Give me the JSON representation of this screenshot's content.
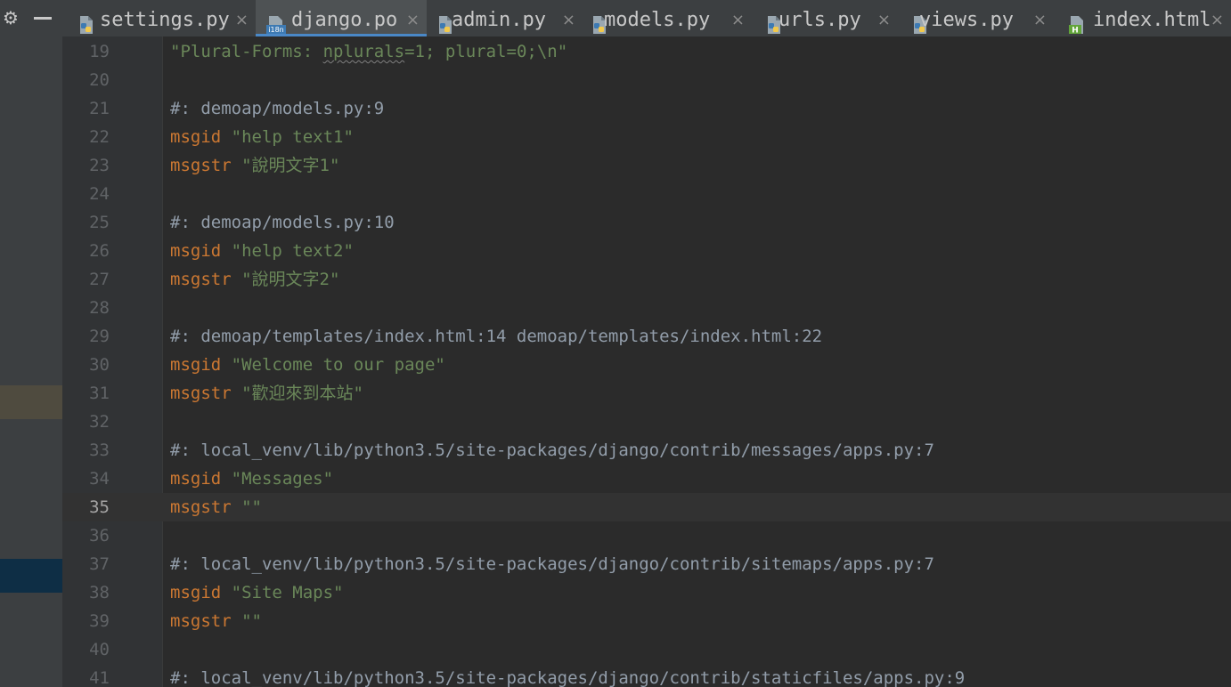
{
  "tabs": [
    {
      "label": "settings.py",
      "icon": "python-file-icon",
      "active": false
    },
    {
      "label": "django.po",
      "icon": "i18n-file-icon",
      "active": true
    },
    {
      "label": "admin.py",
      "icon": "python-file-icon",
      "active": false
    },
    {
      "label": "models.py",
      "icon": "python-file-icon",
      "active": false
    },
    {
      "label": "urls.py",
      "icon": "python-file-icon",
      "active": false
    },
    {
      "label": "views.py",
      "icon": "python-file-icon",
      "active": false
    },
    {
      "label": "index.html",
      "icon": "html-file-icon",
      "active": false
    }
  ],
  "close_glyph": "×",
  "i18n_badge": "i18n",
  "html_badge": "H",
  "editor": {
    "current_line": "35",
    "lines": [
      {
        "num": "19",
        "parts": [
          [
            "str",
            "\"Plural-Forms: "
          ],
          [
            "strsq",
            "nplurals"
          ],
          [
            "str",
            "=1; plural=0;\\n\""
          ]
        ]
      },
      {
        "num": "20",
        "parts": []
      },
      {
        "num": "21",
        "parts": [
          [
            "comment",
            "#: demoap/models.py:9"
          ]
        ]
      },
      {
        "num": "22",
        "parts": [
          [
            "kw",
            "msgid"
          ],
          [
            "plain",
            " "
          ],
          [
            "str",
            "\"help text1\""
          ]
        ]
      },
      {
        "num": "23",
        "parts": [
          [
            "kw",
            "msgstr"
          ],
          [
            "plain",
            " "
          ],
          [
            "str",
            "\"說明文字1\""
          ]
        ]
      },
      {
        "num": "24",
        "parts": []
      },
      {
        "num": "25",
        "parts": [
          [
            "comment",
            "#: demoap/models.py:10"
          ]
        ]
      },
      {
        "num": "26",
        "parts": [
          [
            "kw",
            "msgid"
          ],
          [
            "plain",
            " "
          ],
          [
            "str",
            "\"help text2\""
          ]
        ]
      },
      {
        "num": "27",
        "parts": [
          [
            "kw",
            "msgstr"
          ],
          [
            "plain",
            " "
          ],
          [
            "str",
            "\"說明文字2\""
          ]
        ]
      },
      {
        "num": "28",
        "parts": []
      },
      {
        "num": "29",
        "parts": [
          [
            "comment",
            "#: demoap/templates/index.html:14 demoap/templates/index.html:22"
          ]
        ]
      },
      {
        "num": "30",
        "parts": [
          [
            "kw",
            "msgid"
          ],
          [
            "plain",
            " "
          ],
          [
            "str",
            "\"Welcome to our page\""
          ]
        ]
      },
      {
        "num": "31",
        "parts": [
          [
            "kw",
            "msgstr"
          ],
          [
            "plain",
            " "
          ],
          [
            "str",
            "\"歡迎來到本站\""
          ]
        ]
      },
      {
        "num": "32",
        "parts": []
      },
      {
        "num": "33",
        "parts": [
          [
            "comment",
            "#: local_venv/lib/python3.5/site-packages/django/contrib/messages/apps.py:7"
          ]
        ]
      },
      {
        "num": "34",
        "parts": [
          [
            "kw",
            "msgid"
          ],
          [
            "plain",
            " "
          ],
          [
            "str",
            "\"Messages\""
          ]
        ]
      },
      {
        "num": "35",
        "parts": [
          [
            "kw",
            "msgstr"
          ],
          [
            "plain",
            " "
          ],
          [
            "str",
            "\"\""
          ]
        ]
      },
      {
        "num": "36",
        "parts": []
      },
      {
        "num": "37",
        "parts": [
          [
            "comment",
            "#: local_venv/lib/python3.5/site-packages/django/contrib/sitemaps/apps.py:7"
          ]
        ]
      },
      {
        "num": "38",
        "parts": [
          [
            "kw",
            "msgid"
          ],
          [
            "plain",
            " "
          ],
          [
            "str",
            "\"Site Maps\""
          ]
        ]
      },
      {
        "num": "39",
        "parts": [
          [
            "kw",
            "msgstr"
          ],
          [
            "plain",
            " "
          ],
          [
            "str",
            "\"\""
          ]
        ]
      },
      {
        "num": "40",
        "parts": []
      },
      {
        "num": "41",
        "parts": [
          [
            "comment",
            "#: local_venv/lib/python3.5/site-packages/django/contrib/staticfiles/apps.py:9"
          ]
        ]
      }
    ]
  },
  "colors": {
    "keyword": "#cc7832",
    "string": "#6a8759",
    "comment": "#a9b7c6",
    "background": "#2b2b2b",
    "accent": "#4a88c7"
  }
}
